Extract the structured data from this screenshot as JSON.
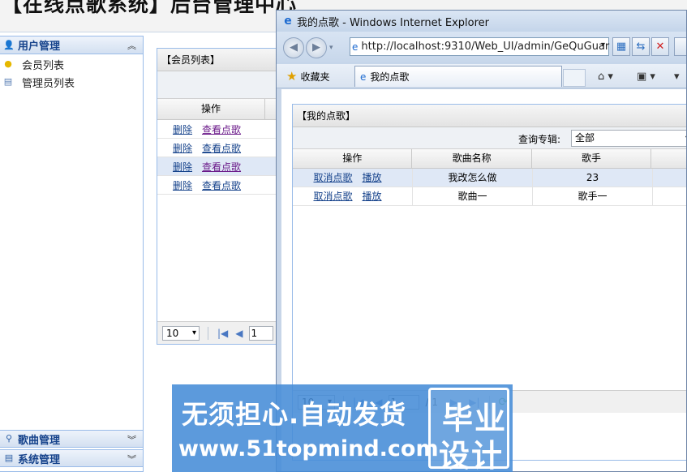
{
  "app": {
    "title": "【在线点歌系统】后台管理中心"
  },
  "sidebar": {
    "sections": [
      {
        "title": "用户管理",
        "icon": "user-icon",
        "expanded": true,
        "items": [
          {
            "label": "会员列表",
            "icon": "bulb-icon"
          },
          {
            "label": "管理员列表",
            "icon": "grid-icon"
          }
        ]
      },
      {
        "title": "歌曲管理",
        "icon": "search-icon",
        "expanded": false
      },
      {
        "title": "系统管理",
        "icon": "grid-icon",
        "expanded": false
      }
    ]
  },
  "member_panel": {
    "title": "【会员列表】",
    "column_header": "操作",
    "rows": [
      {
        "delete": "删除",
        "view": "查看点歌"
      },
      {
        "delete": "删除",
        "view": "查看点歌"
      },
      {
        "delete": "删除",
        "view": "查看点歌"
      },
      {
        "delete": "删除",
        "view": "查看点歌"
      }
    ],
    "pager": {
      "page_size": "10",
      "page": "1"
    }
  },
  "ie": {
    "window_title": "我的点歌 - Windows Internet Explorer",
    "address": "http://localhost:9310/Web_UI/admin/GeQuGuar",
    "favorites": "收藏夹",
    "tab_title": "我的点歌"
  },
  "song_panel": {
    "title": "【我的点歌】",
    "query_label": "查询专辑:",
    "query_value": "全部",
    "columns": [
      "操作",
      "歌曲名称",
      "歌手"
    ],
    "rows": [
      {
        "cancel": "取消点歌",
        "play": "播放",
        "name": "我改怎么做",
        "singer": "23"
      },
      {
        "cancel": "取消点歌",
        "play": "播放",
        "name": "歌曲一",
        "singer": "歌手一"
      }
    ],
    "pager": {
      "page_size": "10",
      "page": "1",
      "total": "/ 1"
    }
  },
  "watermark": {
    "line1": "无须担心.自动发货",
    "line2": "www.51topmind.com",
    "badge1": "毕业",
    "badge2": "设计"
  },
  "colors": {
    "panel_border": "#99bbe8",
    "link": "#15428b",
    "visited_link": "#6b1a8a",
    "watermark": "#468cd7"
  }
}
